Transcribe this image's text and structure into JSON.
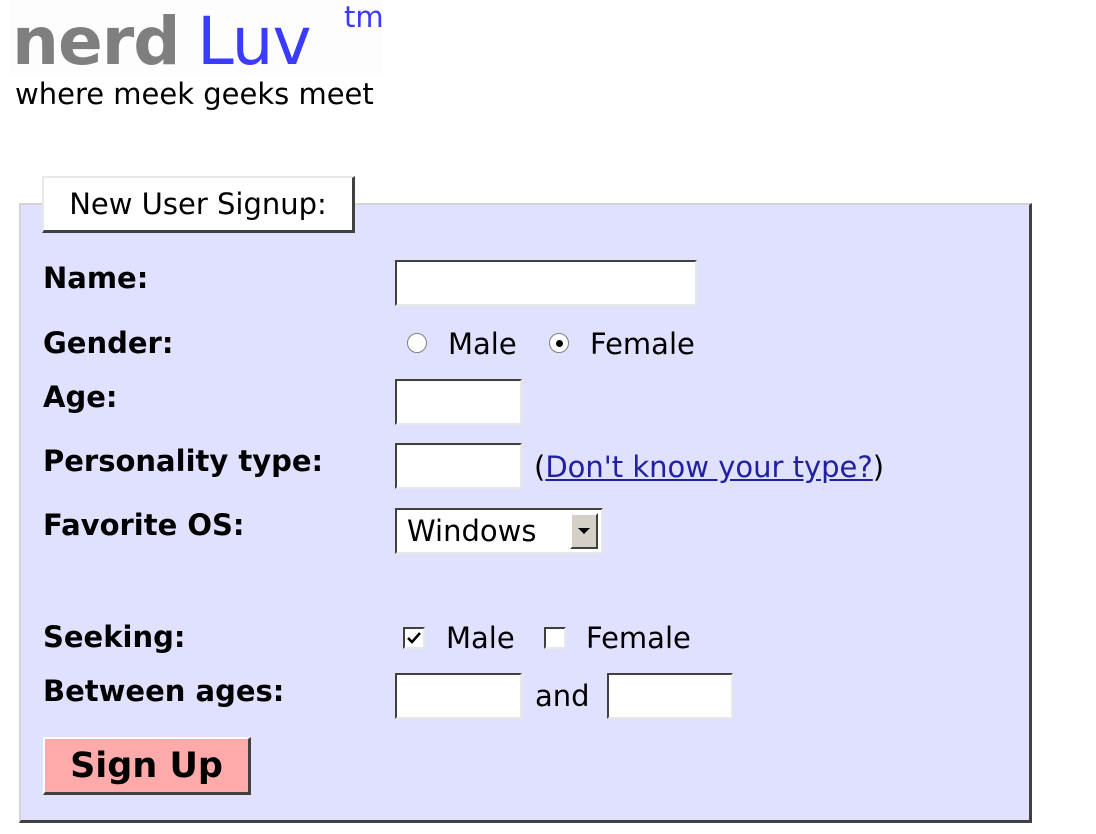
{
  "header": {
    "logo_part1": "nerd",
    "logo_part2": "Luv",
    "logo_tm": "tm",
    "tagline": "where meek geeks meet"
  },
  "form": {
    "legend": "New User Signup:",
    "name_label": "Name:",
    "name_value": "",
    "gender_label": "Gender:",
    "gender_options": [
      "Male",
      "Female"
    ],
    "gender_selected": "Female",
    "age_label": "Age:",
    "age_value": "",
    "personality_label": "Personality type:",
    "personality_value": "",
    "personality_link_open": "(",
    "personality_link_text": "Don't know your type?",
    "personality_link_close": ")",
    "os_label": "Favorite OS:",
    "os_selected": "Windows",
    "seeking_label": "Seeking:",
    "seeking_options": [
      "Male",
      "Female"
    ],
    "seeking_checked": [
      "Male"
    ],
    "between_label": "Between ages:",
    "between_and": "and",
    "min_age_value": "",
    "max_age_value": "",
    "submit_label": "Sign Up"
  },
  "colors": {
    "fieldset_bg": "#e0e0ff",
    "logo_grey": "#7f7f7f",
    "logo_blue": "#3b3bff",
    "button_bg": "#ffaaaa",
    "link": "#2020a0"
  }
}
